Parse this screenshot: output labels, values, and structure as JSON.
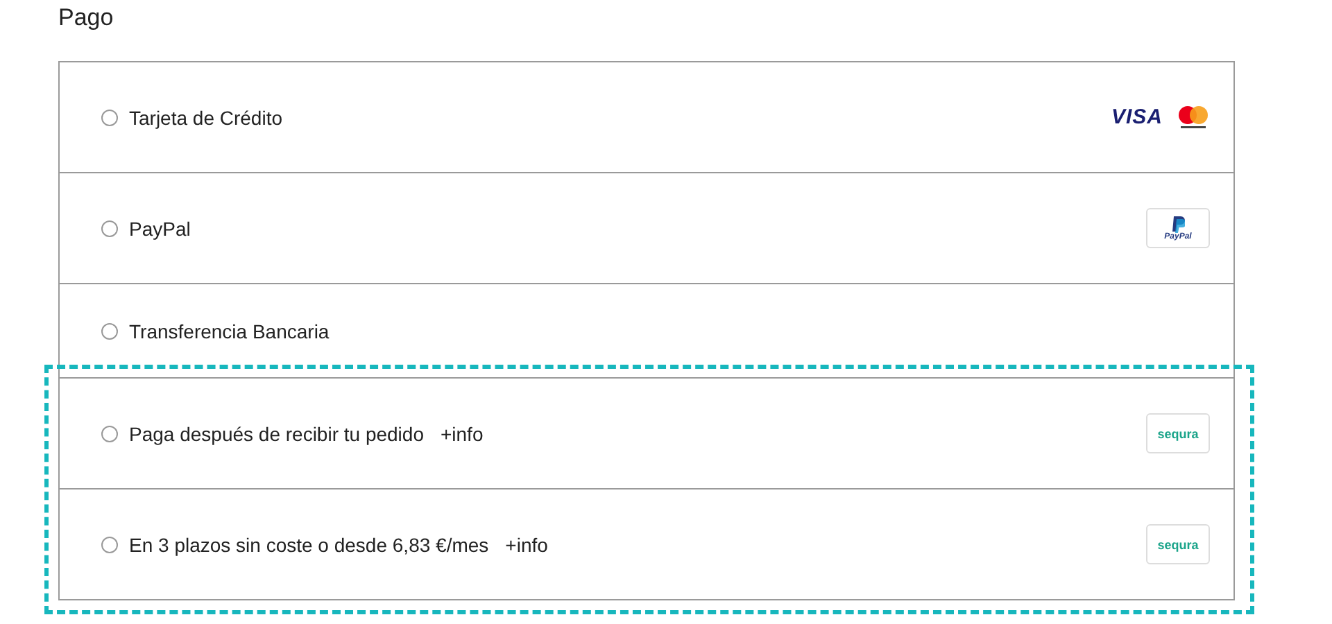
{
  "title": "Pago",
  "methods": [
    {
      "label": "Tarjeta de Crédito",
      "selected": false,
      "logos": [
        {
          "kind": "visa",
          "text": "VISA"
        },
        {
          "kind": "mastercard"
        }
      ]
    },
    {
      "label": "PayPal",
      "selected": false,
      "logos": [
        {
          "kind": "paypal",
          "text": "PayPal"
        }
      ]
    },
    {
      "label": "Transferencia Bancaria",
      "selected": false
    },
    {
      "label": "Paga después de recibir tu pedido",
      "link": "+info",
      "selected": false,
      "highlighted": true,
      "logos": [
        {
          "kind": "sequra",
          "text": "sequra"
        }
      ]
    },
    {
      "label": "En 3 plazos sin coste o desde 6,83 €/mes",
      "link": "+info",
      "selected": false,
      "highlighted": true,
      "logos": [
        {
          "kind": "sequra",
          "text": "sequra"
        }
      ]
    }
  ]
}
